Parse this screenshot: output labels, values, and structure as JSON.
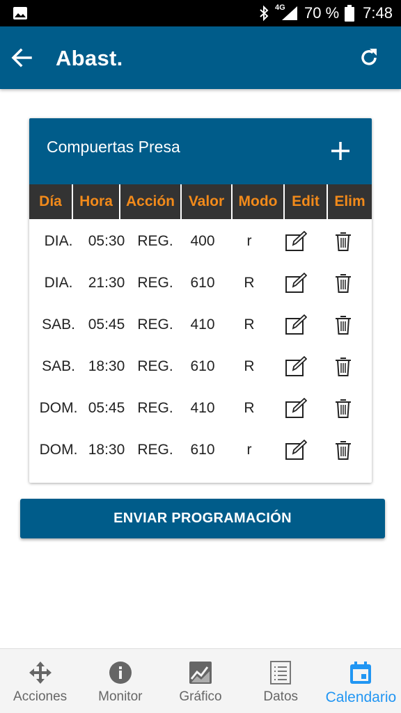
{
  "status_bar": {
    "network": "4G",
    "battery_pct": "70 %",
    "time": "7:48"
  },
  "app_bar": {
    "title": "Abast."
  },
  "card": {
    "title": "Compuertas Presa",
    "columns": [
      "Día",
      "Hora",
      "Acción",
      "Valor",
      "Modo",
      "Edit",
      "Elim"
    ],
    "rows": [
      {
        "dia": "DIA.",
        "hora": "05:30",
        "accion": "REG.",
        "valor": "400",
        "modo": "r"
      },
      {
        "dia": "DIA.",
        "hora": "21:30",
        "accion": "REG.",
        "valor": "610",
        "modo": "R"
      },
      {
        "dia": "SAB.",
        "hora": "05:45",
        "accion": "REG.",
        "valor": "410",
        "modo": "R"
      },
      {
        "dia": "SAB.",
        "hora": "18:30",
        "accion": "REG.",
        "valor": "610",
        "modo": "R"
      },
      {
        "dia": "DOM.",
        "hora": "05:45",
        "accion": "REG.",
        "valor": "410",
        "modo": "R"
      },
      {
        "dia": "DOM.",
        "hora": "18:30",
        "accion": "REG.",
        "valor": "610",
        "modo": "r"
      }
    ]
  },
  "send_button": {
    "label": "ENVIAR PROGRAMACIÓN"
  },
  "bottom_nav": {
    "items": [
      {
        "label": "Acciones",
        "icon": "move-arrows-icon",
        "active": false
      },
      {
        "label": "Monitor",
        "icon": "info-icon",
        "active": false
      },
      {
        "label": "Gráfico",
        "icon": "chart-icon",
        "active": false
      },
      {
        "label": "Datos",
        "icon": "list-icon",
        "active": false
      },
      {
        "label": "Calendario",
        "icon": "calendar-icon",
        "active": true
      }
    ]
  },
  "colors": {
    "primary": "#005c8a",
    "header_cell_bg": "#333333",
    "header_cell_text": "#f28a1a",
    "active_nav": "#2196f3"
  }
}
